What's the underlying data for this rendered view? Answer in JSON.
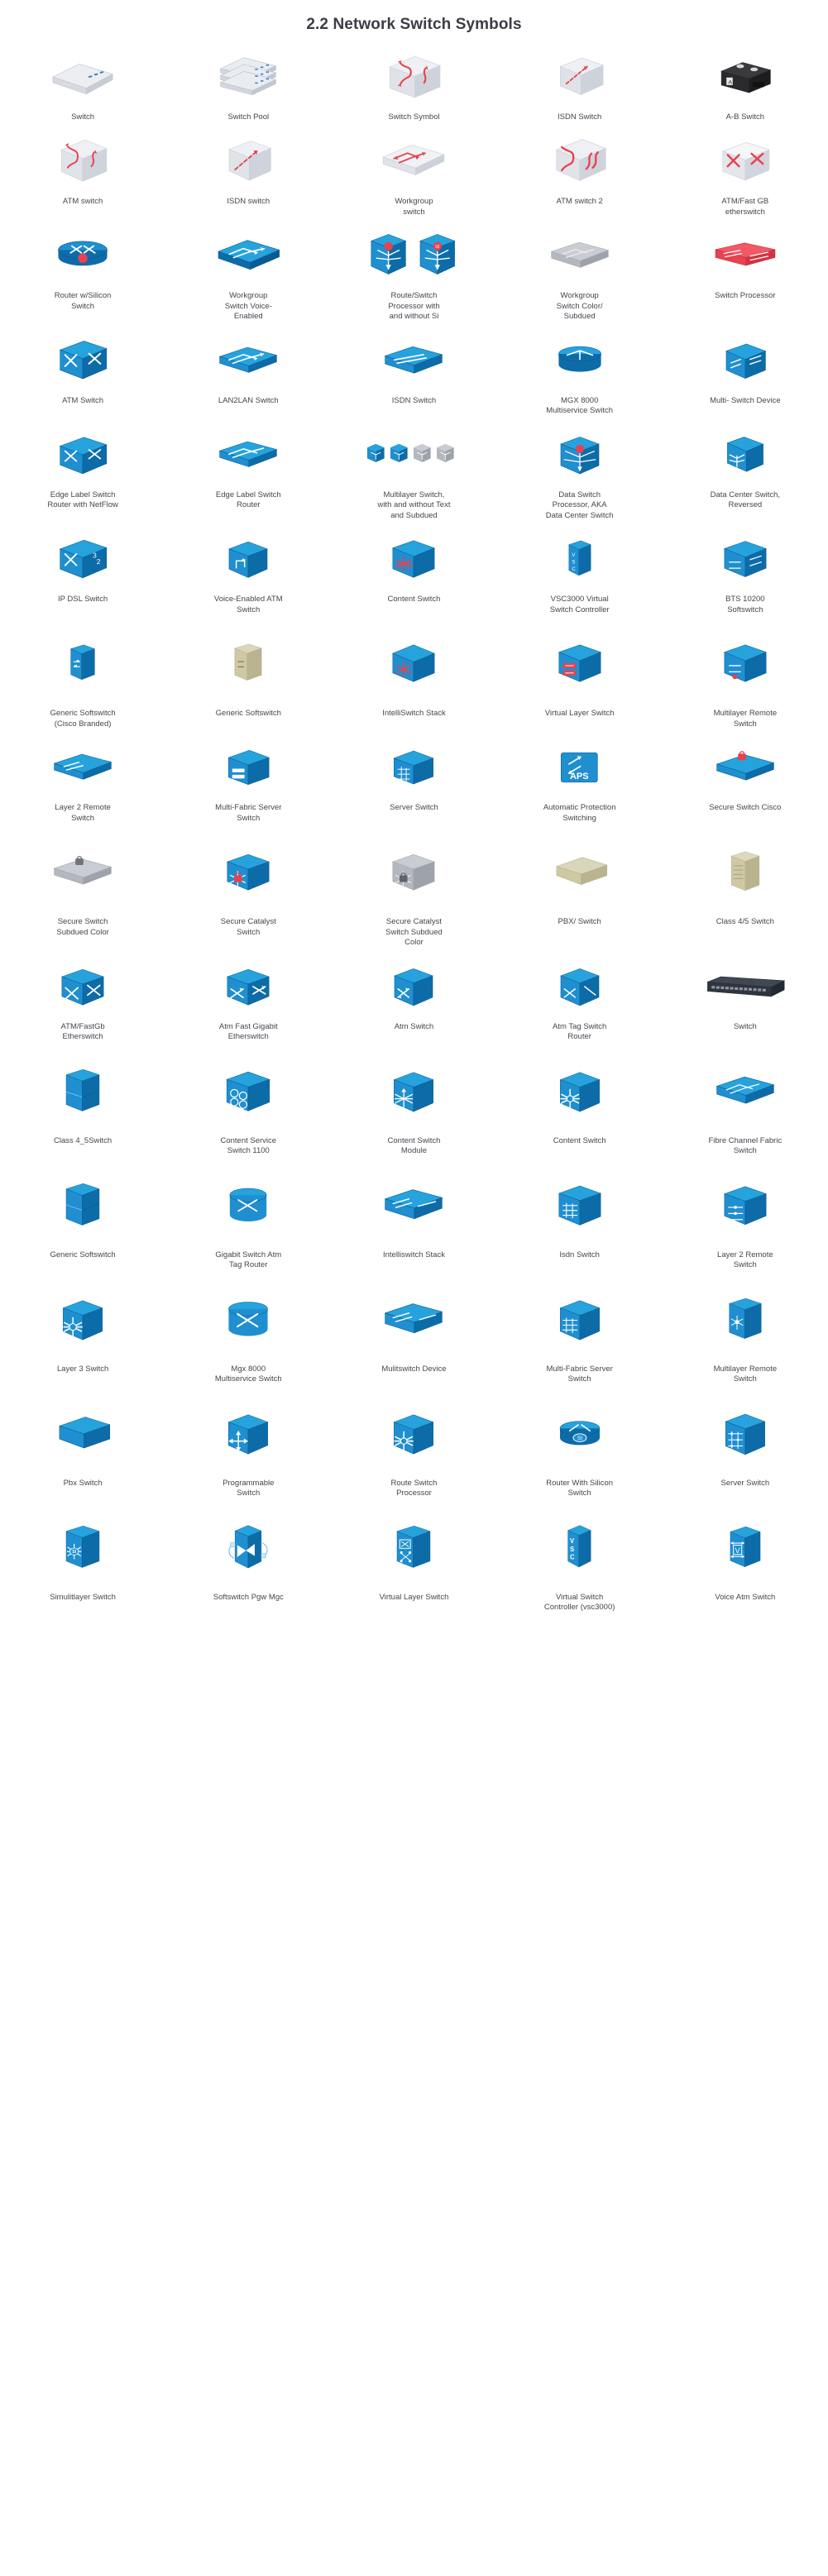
{
  "page": {
    "title": "2.2 Network Switch Symbols",
    "columns": 5,
    "rows": 16,
    "colors": {
      "cisco_blue": "#1f8fd0",
      "cisco_blue_dark": "#0d6ca8",
      "cisco_blue_deep": "#0b5b93",
      "cisco_teal": "#00aeef",
      "red": "#e8414f",
      "red_dark": "#c7303d",
      "grey_light": "#e3e5ea",
      "grey_mid": "#b9bcc4",
      "grey_dark": "#8b8e95",
      "tan": "#cdc9a5",
      "tan_dark": "#b5b08a",
      "black": "#2b2b2b",
      "text": "#46464e"
    }
  },
  "symbols": [
    {
      "label": "Switch",
      "icon": "switch-isometric-white",
      "row": 1,
      "col": 1
    },
    {
      "label": "Switch Pool",
      "icon": "switch-pool-stack",
      "row": 1,
      "col": 2
    },
    {
      "label": "Switch Symbol",
      "icon": "switch-symbol-white-arrows",
      "row": 1,
      "col": 3
    },
    {
      "label": "ISDN Switch",
      "icon": "isdn-switch-white-arrow",
      "row": 1,
      "col": 4
    },
    {
      "label": "A-B Switch",
      "icon": "ab-switch-black-box",
      "row": 1,
      "col": 5
    },
    {
      "label": "ATM switch",
      "icon": "atm-switch-white-red",
      "row": 2,
      "col": 1
    },
    {
      "label": "ISDN switch",
      "icon": "isdn-switch-white-red",
      "row": 2,
      "col": 2
    },
    {
      "label": "Workgroup\nswitch",
      "icon": "workgroup-switch-white",
      "row": 2,
      "col": 3
    },
    {
      "label": "ATM switch 2",
      "icon": "atm-switch-2-white-red",
      "row": 2,
      "col": 4
    },
    {
      "label": "ATM/Fast GB\netherswitch",
      "icon": "atm-fastgb-etherswitch-red",
      "row": 2,
      "col": 5
    },
    {
      "label": "Router w/Silicon\nSwitch",
      "icon": "router-silicon-switch-round",
      "row": 3,
      "col": 1
    },
    {
      "label": "Workgroup\nSwitch Voice-\nEnabled",
      "icon": "workgroup-switch-voice",
      "row": 3,
      "col": 2
    },
    {
      "label": "Route/Switch\nProcessor  with\nand without Si",
      "icon": "route-switch-processor-pair",
      "row": 3,
      "col": 3
    },
    {
      "label": "Workgroup\nSwitch Color/\nSubdued",
      "icon": "workgroup-switch-subdued",
      "row": 3,
      "col": 4
    },
    {
      "label": "Switch Processor",
      "icon": "switch-processor-red",
      "row": 3,
      "col": 5
    },
    {
      "label": "ATM Switch",
      "icon": "atm-switch-blue-x",
      "row": 4,
      "col": 1
    },
    {
      "label": "LAN2LAN Switch",
      "icon": "lan2lan-switch-blue",
      "row": 4,
      "col": 2
    },
    {
      "label": "ISDN Switch",
      "icon": "isdn-switch-blue",
      "row": 4,
      "col": 3
    },
    {
      "label": "MGX 8000\nMultiservice Switch",
      "icon": "mgx-8000-multiservice",
      "row": 4,
      "col": 4
    },
    {
      "label": "Multi- Switch Device",
      "icon": "multi-switch-device",
      "row": 4,
      "col": 5
    },
    {
      "label": "Edge Label  Switch\nRouter  with NetFlow",
      "icon": "edge-label-switch-netflow",
      "row": 5,
      "col": 1
    },
    {
      "label": "Edge Label Switch\nRouter",
      "icon": "edge-label-switch-router",
      "row": 5,
      "col": 2
    },
    {
      "label": "Multilayer Switch,\nwith and without Text\nand Subdued",
      "icon": "multilayer-switch-set",
      "row": 5,
      "col": 3
    },
    {
      "label": "Data Switch\nProcessor,  AKA\nData  Center Switch",
      "icon": "data-switch-processor",
      "row": 5,
      "col": 4
    },
    {
      "label": "Data Center Switch,\nReversed",
      "icon": "data-center-switch-reversed",
      "row": 5,
      "col": 5
    },
    {
      "label": "IP DSL Switch",
      "icon": "ip-dsl-switch",
      "row": 6,
      "col": 1
    },
    {
      "label": "Voice-Enabled ATM\nSwitch",
      "icon": "voice-enabled-atm-switch",
      "row": 6,
      "col": 2
    },
    {
      "label": "Content  Switch",
      "icon": "content-switch-star",
      "row": 6,
      "col": 3
    },
    {
      "label": "VSC3000 Virtual\nSwitch Controller",
      "icon": "vsc3000-virtual-controller",
      "row": 6,
      "col": 4
    },
    {
      "label": "BTS 10200\nSoftswitch",
      "icon": "bts-10200-softswitch",
      "row": 6,
      "col": 5
    },
    {
      "label": "Generic Softswitch\n(Cisco Branded)",
      "icon": "generic-softswitch-cisco",
      "row": 7,
      "col": 1
    },
    {
      "label": "Generic Softswitch",
      "icon": "generic-softswitch",
      "row": 7,
      "col": 2
    },
    {
      "label": "IntelliSwitch Stack",
      "icon": "intelliswitch-stack",
      "row": 7,
      "col": 3
    },
    {
      "label": "Virtual Layer Switch",
      "icon": "virtual-layer-switch",
      "row": 7,
      "col": 4
    },
    {
      "label": "Multilayer Remote\nSwitch",
      "icon": "multilayer-remote-switch",
      "row": 7,
      "col": 5
    },
    {
      "label": "Layer 2 Remote\nSwitch",
      "icon": "layer-2-remote-switch",
      "row": 8,
      "col": 1
    },
    {
      "label": "Multi-Fabric Server\nSwitch",
      "icon": "multi-fabric-server-switch",
      "row": 8,
      "col": 2
    },
    {
      "label": "Server Switch",
      "icon": "server-switch-grid",
      "row": 8,
      "col": 3
    },
    {
      "label": "Automatic Protection\nSwitching",
      "icon": "aps-automatic-protection",
      "row": 8,
      "col": 4
    },
    {
      "label": "Secure Switch Cisco",
      "icon": "secure-switch-cisco",
      "row": 8,
      "col": 5
    },
    {
      "label": "Secure Switch\nSubdued Color",
      "icon": "secure-switch-subdued",
      "row": 9,
      "col": 1
    },
    {
      "label": "Secure Catalyst\nSwitch",
      "icon": "secure-catalyst-switch",
      "row": 9,
      "col": 2
    },
    {
      "label": "Secure Catalyst\nSwitch  Subdued\nColor",
      "icon": "secure-catalyst-subdued",
      "row": 9,
      "col": 3
    },
    {
      "label": "PBX/ Switch",
      "icon": "pbx-switch-tan",
      "row": 9,
      "col": 4
    },
    {
      "label": "Class 4/5 Switch",
      "icon": "class-45-switch-tan",
      "row": 9,
      "col": 5
    },
    {
      "label": "ATM/FastGb\nEtherswitch",
      "icon": "atm-fastgb-etherswitch-blue",
      "row": 10,
      "col": 1
    },
    {
      "label": "Atm Fast Gigabit\nEtherswitch",
      "icon": "atm-fast-gigabit-etherswitch",
      "row": 10,
      "col": 2
    },
    {
      "label": "Atm Switch",
      "icon": "atm-switch-box-arrows",
      "row": 10,
      "col": 3
    },
    {
      "label": "Atm Tag Switch\nRouter",
      "icon": "atm-tag-switch-router",
      "row": 10,
      "col": 4
    },
    {
      "label": "Switch",
      "icon": "switch-rack-unit",
      "row": 10,
      "col": 5
    },
    {
      "label": "Class 4_5Switch",
      "icon": "class-4-5-switch-box",
      "row": 11,
      "col": 1
    },
    {
      "label": "Content Service\nSwitch 1100",
      "icon": "content-service-switch-1100",
      "row": 11,
      "col": 2
    },
    {
      "label": "Content Switch\nModule",
      "icon": "content-switch-module",
      "row": 11,
      "col": 3
    },
    {
      "label": "Content Switch",
      "icon": "content-switch-burst",
      "row": 11,
      "col": 4
    },
    {
      "label": "Fibre Channel Fabric\nSwitch",
      "icon": "fibre-channel-fabric-switch",
      "row": 11,
      "col": 5
    },
    {
      "label": "Generic Softswitch",
      "icon": "generic-softswitch-box",
      "row": 12,
      "col": 1
    },
    {
      "label": "Gigabit Switch Atm\nTag Router",
      "icon": "gigabit-switch-atm-tag",
      "row": 12,
      "col": 2
    },
    {
      "label": "Intelliswitch Stack",
      "icon": "intelliswitch-stack-2",
      "row": 12,
      "col": 3
    },
    {
      "label": "Isdn Switch",
      "icon": "isdn-switch-arrows",
      "row": 12,
      "col": 4
    },
    {
      "label": "Layer 2 Remote\nSwitch",
      "icon": "layer-2-remote-switch-2",
      "row": 12,
      "col": 5
    },
    {
      "label": "Layer 3 Switch",
      "icon": "layer-3-switch-burst",
      "row": 13,
      "col": 1
    },
    {
      "label": "Mgx 8000\nMultiservice Switch",
      "icon": "mgx-8000-cylinder",
      "row": 13,
      "col": 2
    },
    {
      "label": "Mulitswitch Device",
      "icon": "multiswitch-device-2",
      "row": 13,
      "col": 3
    },
    {
      "label": "Multi-Fabric Server\nSwitch",
      "icon": "multi-fabric-server-switch-2",
      "row": 13,
      "col": 4
    },
    {
      "label": "Multilayer Remote\nSwitch",
      "icon": "multilayer-remote-switch-2",
      "row": 13,
      "col": 5
    },
    {
      "label": "Pbx Switch",
      "icon": "pbx-switch-box",
      "row": 14,
      "col": 1
    },
    {
      "label": "Programmable\nSwitch",
      "icon": "programmable-switch",
      "row": 14,
      "col": 2
    },
    {
      "label": "Route Switch\nProcessor",
      "icon": "route-switch-processor-2",
      "row": 14,
      "col": 3
    },
    {
      "label": "Router With Silicon\nSwitch",
      "icon": "router-with-silicon-switch",
      "row": 14,
      "col": 4
    },
    {
      "label": "Server Switch",
      "icon": "server-switch-grid-2",
      "row": 14,
      "col": 5
    },
    {
      "label": "Simulitlayer Switch",
      "icon": "simultilayer-switch-si",
      "row": 15,
      "col": 1
    },
    {
      "label": "Softswitch Pgw Mgc",
      "icon": "softswitch-pgw-mgc",
      "row": 15,
      "col": 2
    },
    {
      "label": "Virtual Layer Switch",
      "icon": "virtual-layer-switch-2",
      "row": 15,
      "col": 3
    },
    {
      "label": "Virtual Switch\nController (vsc3000)",
      "icon": "virtual-switch-controller",
      "row": 15,
      "col": 4
    },
    {
      "label": "Voice Atm Switch",
      "icon": "voice-atm-switch-v",
      "row": 15,
      "col": 5
    }
  ]
}
